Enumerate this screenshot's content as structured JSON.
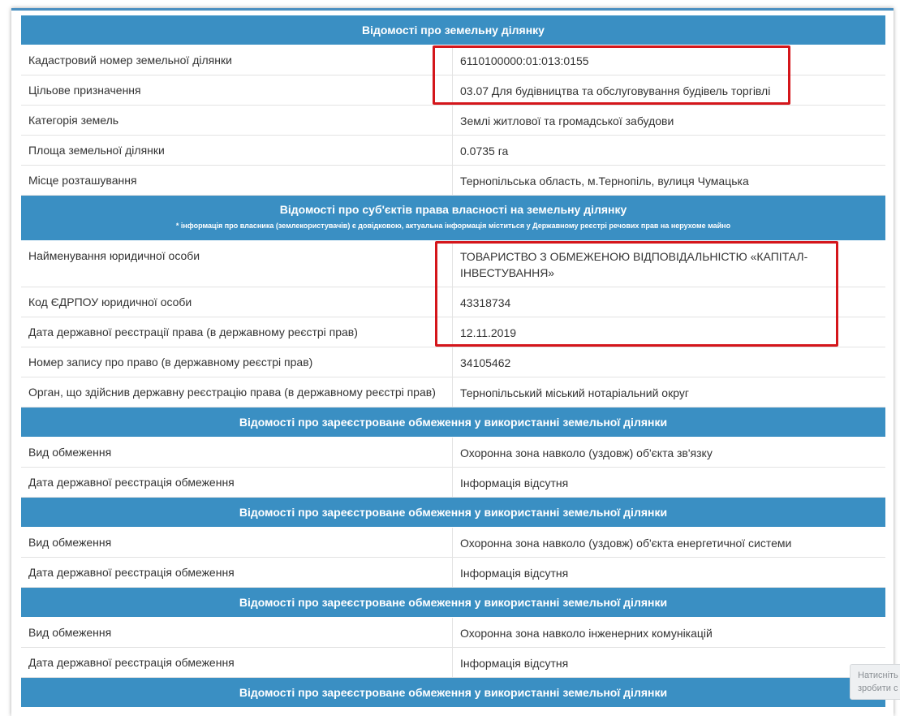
{
  "sections": {
    "land": {
      "title": "Відомості про земельну ділянку",
      "rows": [
        {
          "label": "Кадастровий номер земельної ділянки",
          "value": "6110100000:01:013:0155"
        },
        {
          "label": "Цільове призначення",
          "value": "03.07 Для будівництва та обслуговування будівель торгівлі"
        },
        {
          "label": "Категорія земель",
          "value": "Землі житлової та громадської забудови"
        },
        {
          "label": "Площа земельної ділянки",
          "value": "0.0735 га"
        },
        {
          "label": "Місце розташування",
          "value": "Тернопільська область, м.Тернопіль, вулиця Чумацька"
        }
      ]
    },
    "owners": {
      "title": "Відомості про суб'єктів права власності на земельну ділянку",
      "note": "* інформація про власника (землекористувачів) є довідковою, актуальна інформація міститься у Державному реєстрі речових прав на нерухоме майно",
      "rows": [
        {
          "label": "Найменування юридичної особи",
          "value": "ТОВАРИСТВО З ОБМЕЖЕНОЮ ВІДПОВІДАЛЬНІСТЮ «КАПІТАЛ-ІНВЕСТУВАННЯ»"
        },
        {
          "label": "Код ЄДРПОУ юридичної особи",
          "value": "43318734"
        },
        {
          "label": "Дата державної реєстрації права (в державному реєстрі прав)",
          "value": "12.11.2019"
        },
        {
          "label": "Номер запису про право (в державному реєстрі прав)",
          "value": "34105462"
        },
        {
          "label": "Орган, що здійснив державну реєстрацію права (в державному реєстрі прав)",
          "value": "Тернопільський міський нотаріальний округ"
        }
      ]
    },
    "restrictions": [
      {
        "title": "Відомості про зареєстроване обмеження у використанні земельної ділянки",
        "rows": [
          {
            "label": "Вид обмеження",
            "value": "Охоронна зона навколо (уздовж) об'єкта зв'язку"
          },
          {
            "label": "Дата державної реєстрація обмеження",
            "value": "Інформація відсутня"
          }
        ]
      },
      {
        "title": "Відомості про зареєстроване обмеження у використанні земельної ділянки",
        "rows": [
          {
            "label": "Вид обмеження",
            "value": "Охоронна зона навколо (уздовж) об'єкта енергетичної системи"
          },
          {
            "label": "Дата державної реєстрація обмеження",
            "value": "Інформація відсутня"
          }
        ]
      },
      {
        "title": "Відомості про зареєстроване обмеження у використанні земельної ділянки",
        "rows": [
          {
            "label": "Вид обмеження",
            "value": "Охоронна зона навколо інженерних комунікацій"
          },
          {
            "label": "Дата державної реєстрація обмеження",
            "value": "Інформація відсутня"
          }
        ]
      },
      {
        "title": "Відомості про зареєстроване обмеження у використанні земельної ділянки"
      }
    ]
  },
  "tooltip": {
    "line1": "Натисніть",
    "line2": "зробити с"
  },
  "colors": {
    "header_bg": "#3a8fc3",
    "highlight": "#d4161b"
  }
}
